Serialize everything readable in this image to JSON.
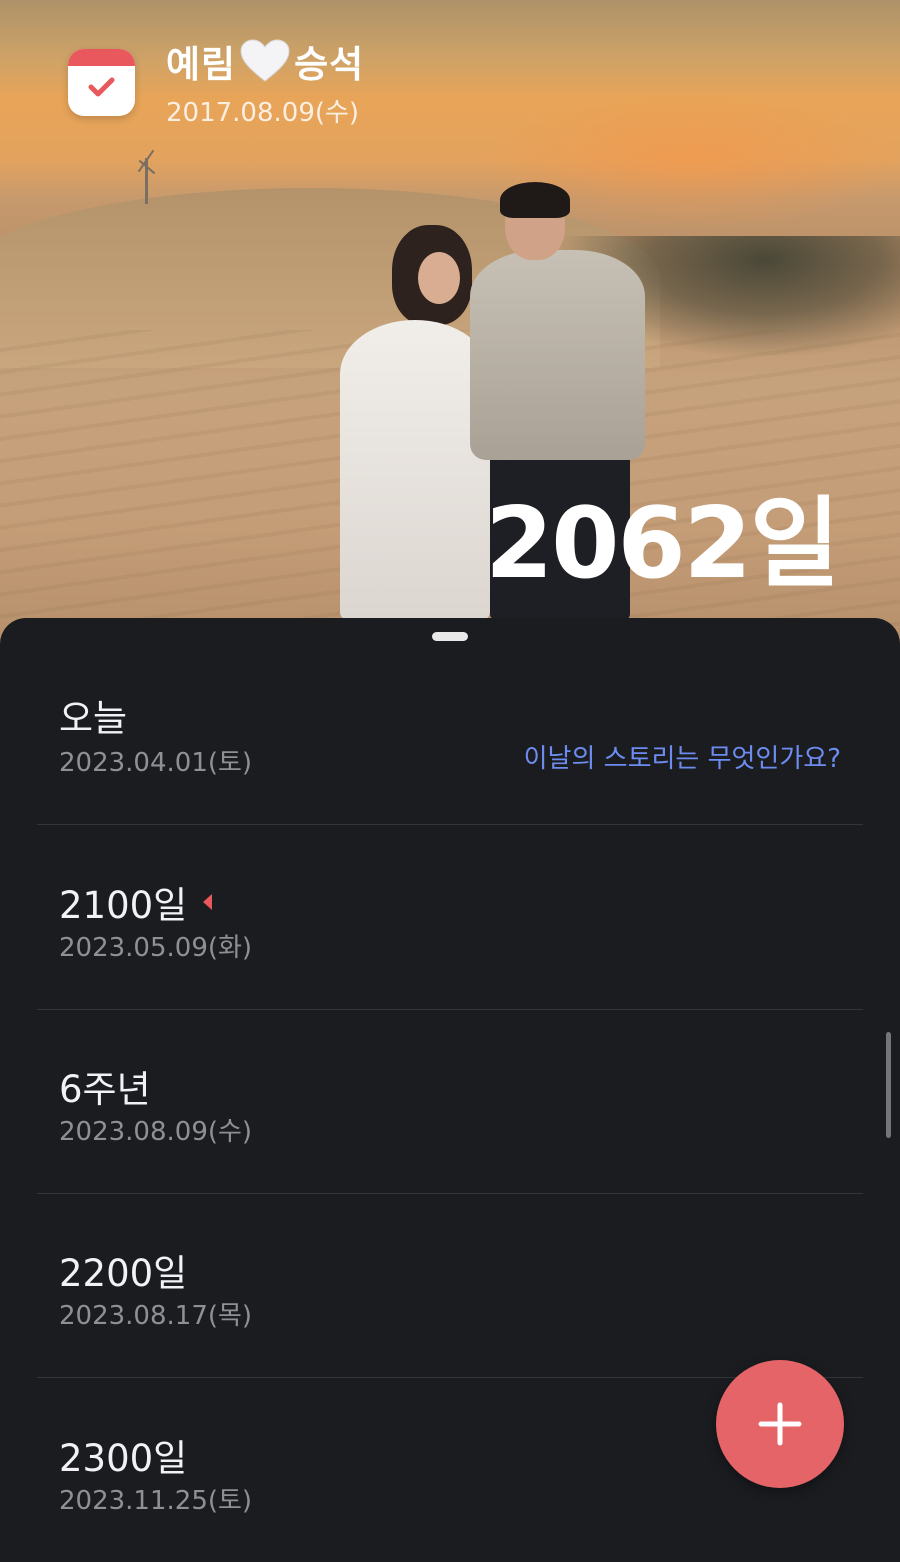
{
  "header": {
    "name_left": "예림",
    "name_right": "승석",
    "start_date": "2017.08.09(수)",
    "day_count": "2062일"
  },
  "icons": {
    "app": "calendar-check-icon",
    "heart": "white-heart-icon",
    "flag": "red-flag-icon",
    "add": "plus-icon"
  },
  "colors": {
    "accent": "#e46468",
    "link": "#6d8cf0",
    "sheet_bg": "#1b1c20"
  },
  "events": [
    {
      "title": "오늘",
      "date": "2023.04.01(토)",
      "note": "이날의 스토리는 무엇인가요?"
    },
    {
      "title": "2100일",
      "date": "2023.05.09(화)"
    },
    {
      "title": "6주년",
      "date": "2023.08.09(수)"
    },
    {
      "title": "2200일",
      "date": "2023.08.17(목)"
    },
    {
      "title": "2300일",
      "date": "2023.11.25(토)"
    }
  ]
}
